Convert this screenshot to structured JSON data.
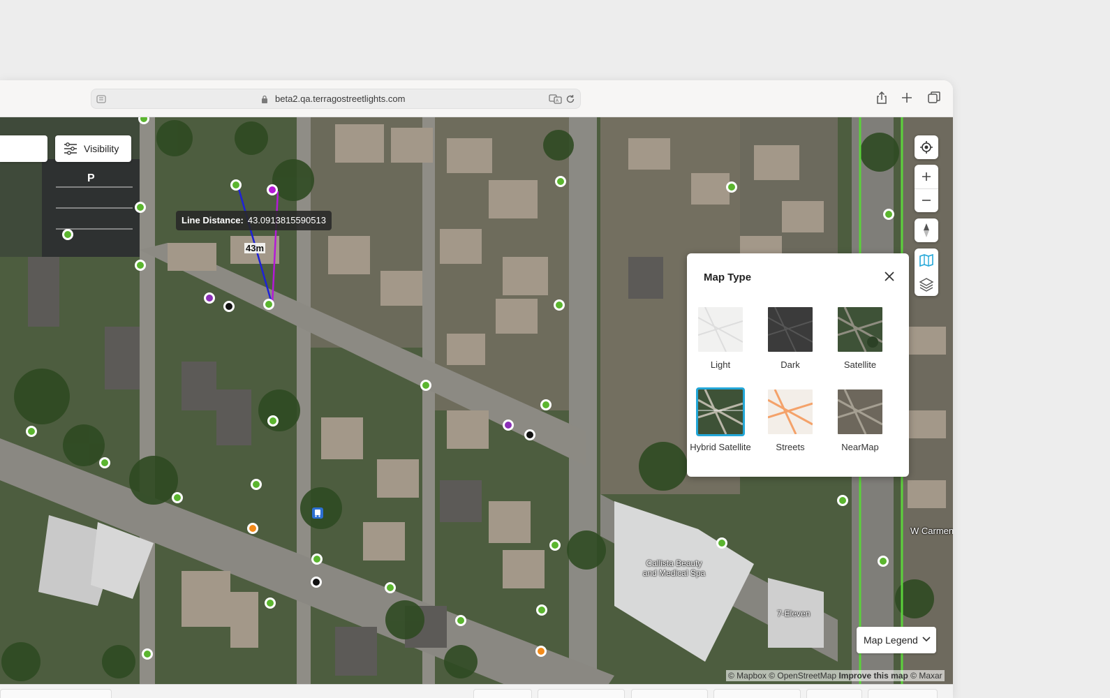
{
  "browser": {
    "url": "beta2.qa.terragostreetlights.com",
    "icons": [
      "sidebar-icon",
      "lock-icon",
      "translate-icon",
      "reload-icon",
      "share-icon",
      "new-tab-icon",
      "tabs-overview-icon"
    ]
  },
  "map": {
    "visibility_label": "Visibility",
    "measure": {
      "label": "Line Distance:",
      "value": "43.0913815590513",
      "segment_label": "43m"
    },
    "controls": [
      "locate-icon",
      "zoom-in-icon",
      "zoom-out-icon",
      "compass-icon",
      "map-type-icon",
      "layers-icon"
    ],
    "map_type_panel": {
      "title": "Map Type",
      "options": [
        {
          "label": "Light",
          "selected": false
        },
        {
          "label": "Dark",
          "selected": false
        },
        {
          "label": "Satellite",
          "selected": false
        },
        {
          "label": "Hybrid Satellite",
          "selected": true
        },
        {
          "label": "Streets",
          "selected": false
        },
        {
          "label": "NearMap",
          "selected": false
        }
      ]
    },
    "legend_label": "Map Legend",
    "place_labels": [
      "Callista Beauty and Medical Spa",
      "7-Eleven",
      "W Carmen"
    ],
    "parking_label": "P",
    "attribution": {
      "text": "© Mapbox © OpenStreetMap",
      "link": "Improve this map",
      "suffix": "© Maxar"
    },
    "colors": {
      "pin_green": "#5bb52f",
      "pin_purple": "#8b2fb8",
      "pin_magenta": "#b41ad6",
      "pin_black": "#111111",
      "pin_orange": "#f28a1a",
      "accent_selected": "#23a7d8"
    }
  }
}
